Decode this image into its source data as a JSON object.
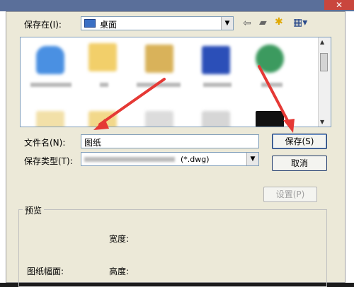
{
  "dialog": {
    "save_in_label": "保存在(I):",
    "location_value": "桌面",
    "file_name_label": "文件名(N):",
    "file_name_value": "图纸",
    "save_type_label": "保存类型(T):",
    "save_type_value": "(*.dwg)",
    "save_button": "保存(S)",
    "cancel_button": "取消",
    "settings_button": "设置(P)",
    "preview_group": "预览",
    "width_label": "宽度:",
    "drawing_size_label": "图纸幅面:",
    "height_label": "高度:"
  },
  "icons": {
    "folder": "folder-icon",
    "desktop": "desktop-icon",
    "back": "back-arrow-icon",
    "up_folder": "up-folder-icon",
    "new_folder": "new-folder-icon",
    "views": "views-menu-icon"
  },
  "colors": {
    "annotation_arrow": "#e53935",
    "dialog_bg": "#ece9d8"
  }
}
